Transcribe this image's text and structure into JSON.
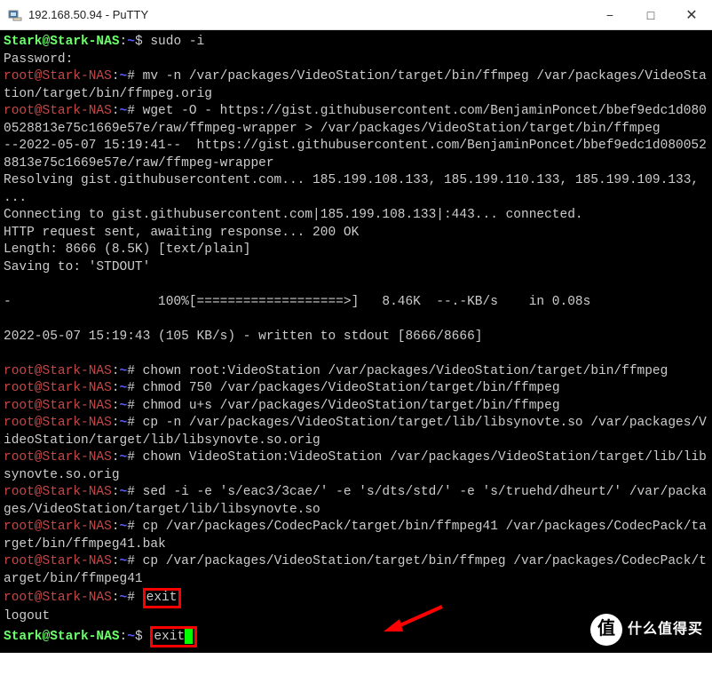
{
  "window": {
    "title": "192.168.50.94 - PuTTY",
    "minimize_glyph": "−",
    "maximize_glyph": "□",
    "close_glyph": "✕"
  },
  "prompt": {
    "user_host_user": "Stark@Stark-NAS",
    "user_host_root": "root@Stark-NAS",
    "path": "~",
    "user_sigil": "$",
    "root_sigil": "#"
  },
  "lines": [
    {
      "prompt": "user",
      "cmd": "sudo -i"
    },
    {
      "plain": "Password:"
    },
    {
      "prompt": "root",
      "cmd": "mv -n /var/packages/VideoStation/target/bin/ffmpeg /var/packages/VideoStation/target/bin/ffmpeg.orig"
    },
    {
      "prompt": "root",
      "cmd": "wget -O - https://gist.githubusercontent.com/BenjaminPoncet/bbef9edc1d0800528813e75c1669e57e/raw/ffmpeg-wrapper > /var/packages/VideoStation/target/bin/ffmpeg"
    },
    {
      "plain": "--2022-05-07 15:19:41--  https://gist.githubusercontent.com/BenjaminPoncet/bbef9edc1d0800528813e75c1669e57e/raw/ffmpeg-wrapper"
    },
    {
      "plain": "Resolving gist.githubusercontent.com... 185.199.108.133, 185.199.110.133, 185.199.109.133, ..."
    },
    {
      "plain": "Connecting to gist.githubusercontent.com|185.199.108.133|:443... connected."
    },
    {
      "plain": "HTTP request sent, awaiting response... 200 OK"
    },
    {
      "plain": "Length: 8666 (8.5K) [text/plain]"
    },
    {
      "plain": "Saving to: 'STDOUT'"
    },
    {
      "plain": ""
    },
    {
      "plain": "-                   100%[===================>]   8.46K  --.-KB/s    in 0.08s"
    },
    {
      "plain": ""
    },
    {
      "plain": "2022-05-07 15:19:43 (105 KB/s) - written to stdout [8666/8666]"
    },
    {
      "plain": ""
    },
    {
      "prompt": "root",
      "cmd": "chown root:VideoStation /var/packages/VideoStation/target/bin/ffmpeg"
    },
    {
      "prompt": "root",
      "cmd": "chmod 750 /var/packages/VideoStation/target/bin/ffmpeg"
    },
    {
      "prompt": "root",
      "cmd": "chmod u+s /var/packages/VideoStation/target/bin/ffmpeg"
    },
    {
      "prompt": "root",
      "cmd": "cp -n /var/packages/VideoStation/target/lib/libsynovte.so /var/packages/VideoStation/target/lib/libsynovte.so.orig"
    },
    {
      "prompt": "root",
      "cmd": "chown VideoStation:VideoStation /var/packages/VideoStation/target/lib/libsynovte.so.orig"
    },
    {
      "prompt": "root",
      "cmd": "sed -i -e 's/eac3/3cae/' -e 's/dts/std/' -e 's/truehd/dheurt/' /var/packages/VideoStation/target/lib/libsynovte.so"
    },
    {
      "prompt": "root",
      "cmd": "cp /var/packages/CodecPack/target/bin/ffmpeg41 /var/packages/CodecPack/target/bin/ffmpeg41.bak"
    },
    {
      "prompt": "root",
      "cmd": "cp /var/packages/VideoStation/target/bin/ffmpeg /var/packages/CodecPack/target/bin/ffmpeg41"
    },
    {
      "prompt": "root",
      "cmd": "exit",
      "boxed": true
    },
    {
      "plain": "logout"
    },
    {
      "prompt": "user",
      "cmd": "exit",
      "boxed": true,
      "cursor": true
    }
  ],
  "watermark": {
    "char": "值",
    "text": "什么值得买"
  }
}
